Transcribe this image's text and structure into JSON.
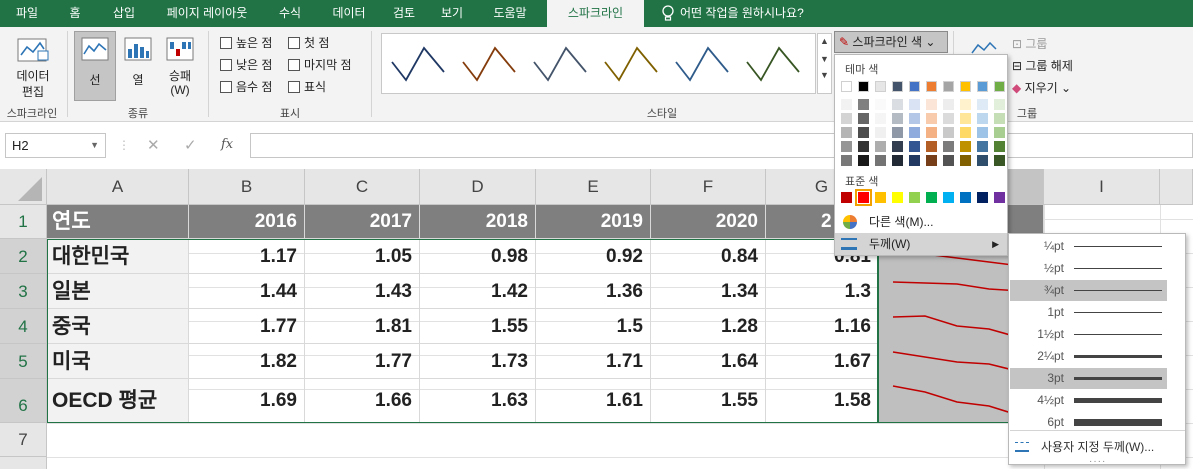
{
  "tabs": [
    "파일",
    "홈",
    "삽입",
    "페이지 레이아웃",
    "수식",
    "데이터",
    "검토",
    "보기",
    "도움말",
    "스파크라인"
  ],
  "tell_me": "어떤 작업을 원하시나요?",
  "ribbon": {
    "edit_data": "데이터\n편집",
    "edit_data_l1": "데이터",
    "edit_data_l2": "편집",
    "group_sparkline": "스파크라인",
    "type_line": "선",
    "type_column": "열",
    "type_winloss_l1": "승패",
    "type_winloss_l2": "(W)",
    "group_type": "종류",
    "show": {
      "high": "높은 점",
      "low": "낮은 점",
      "negative": "음수 점",
      "first": "첫 점",
      "last": "마지막 점",
      "markers": "표식"
    },
    "group_show": "표시",
    "group_style": "스타일",
    "sparkline_color": "스파크라인 색",
    "group_label": "그룹",
    "ungroup": "그룹 해제",
    "clear": "지우기",
    "group_group": "그룹"
  },
  "namebox": "H2",
  "fx_label": "fx",
  "columns": [
    "A",
    "B",
    "C",
    "D",
    "E",
    "F",
    "G",
    "",
    "I"
  ],
  "rows": [
    "1",
    "2",
    "3",
    "4",
    "5",
    "6",
    "7"
  ],
  "table": {
    "header": [
      "연도",
      "2016",
      "2017",
      "2018",
      "2019",
      "2020",
      "2"
    ],
    "data": [
      [
        "대한민국",
        "1.17",
        "1.05",
        "0.98",
        "0.92",
        "0.84",
        "0.81"
      ],
      [
        "일본",
        "1.44",
        "1.43",
        "1.42",
        "1.36",
        "1.34",
        "1.3"
      ],
      [
        "중국",
        "1.77",
        "1.81",
        "1.55",
        "1.5",
        "1.28",
        "1.16"
      ],
      [
        "미국",
        "1.82",
        "1.77",
        "1.73",
        "1.71",
        "1.64",
        "1.67"
      ],
      [
        "OECD 평균",
        "1.69",
        "1.66",
        "1.63",
        "1.61",
        "1.55",
        "1.58"
      ]
    ]
  },
  "color_menu": {
    "theme_label": "테마 색",
    "standard_label": "표준 색",
    "more_colors": "다른 색(M)...",
    "weight": "두께(W)",
    "theme_top": [
      "#ffffff",
      "#000000",
      "#e7e6e6",
      "#44546a",
      "#4472c4",
      "#ed7d31",
      "#a5a5a5",
      "#ffc000",
      "#5b9bd5",
      "#70ad47"
    ],
    "standard": [
      "#c00000",
      "#ff0000",
      "#ffc000",
      "#ffff00",
      "#92d050",
      "#00b050",
      "#00b0f0",
      "#0070c0",
      "#002060",
      "#7030a0"
    ]
  },
  "weight_menu": {
    "items": [
      "¼pt",
      "½pt",
      "¾pt",
      "1pt",
      "1½pt",
      "2¼pt",
      "3pt",
      "4½pt",
      "6pt"
    ],
    "selected": [
      "¾pt",
      "3pt"
    ],
    "custom": "사용자 지정 두께(W)..."
  },
  "accent": "#217346"
}
